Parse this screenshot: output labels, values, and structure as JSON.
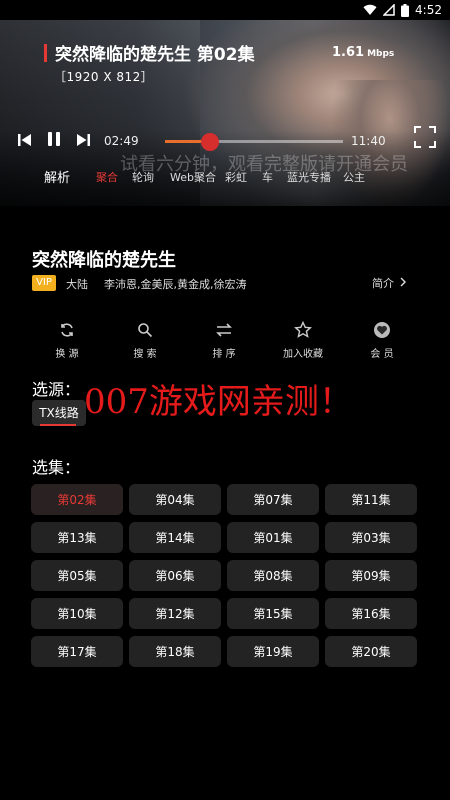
{
  "status_bar": {
    "time": "4:52"
  },
  "player": {
    "title": "突然降临的楚先生 第02集",
    "resolution": "［1920 X 812］",
    "speed_value": "1.61",
    "speed_unit": "Mbps",
    "current_time": "02:49",
    "total_time": "11:40",
    "progress": 0.25,
    "watermark": "试看六分钟，观看完整版请开通会员"
  },
  "parse": {
    "label": "解析",
    "sources": [
      "聚合",
      "轮询",
      "Web聚合",
      "彩虹",
      "车",
      "蓝光专播",
      "公主"
    ],
    "active_index": 0
  },
  "show": {
    "title": "突然降临的楚先生",
    "vip": "VIP",
    "region": "大陆",
    "cast": "李沛恩,金美辰,黄金成,徐宏涛",
    "intro": "简介"
  },
  "actions": [
    {
      "label": "换 源",
      "icon": "refresh-icon"
    },
    {
      "label": "搜 索",
      "icon": "search-icon"
    },
    {
      "label": "排 序",
      "icon": "sort-icon"
    },
    {
      "label": "加入收藏",
      "icon": "star-icon"
    },
    {
      "label": "会 员",
      "icon": "vip-heart-icon"
    }
  ],
  "lines": {
    "label": "选源：",
    "current": "TX线路"
  },
  "promo_text": "007游戏网亲测！",
  "episodes": {
    "label": "选集：",
    "items": [
      "第02集",
      "第04集",
      "第07集",
      "第11集",
      "第13集",
      "第14集",
      "第01集",
      "第03集",
      "第05集",
      "第06集",
      "第08集",
      "第09集",
      "第10集",
      "第12集",
      "第15集",
      "第16集",
      "第17集",
      "第18集",
      "第19集",
      "第20集"
    ],
    "active_index": 0
  },
  "colors": {
    "accent": "#e53935",
    "vip": "#f2b01e",
    "progress": "#e86e2c"
  }
}
